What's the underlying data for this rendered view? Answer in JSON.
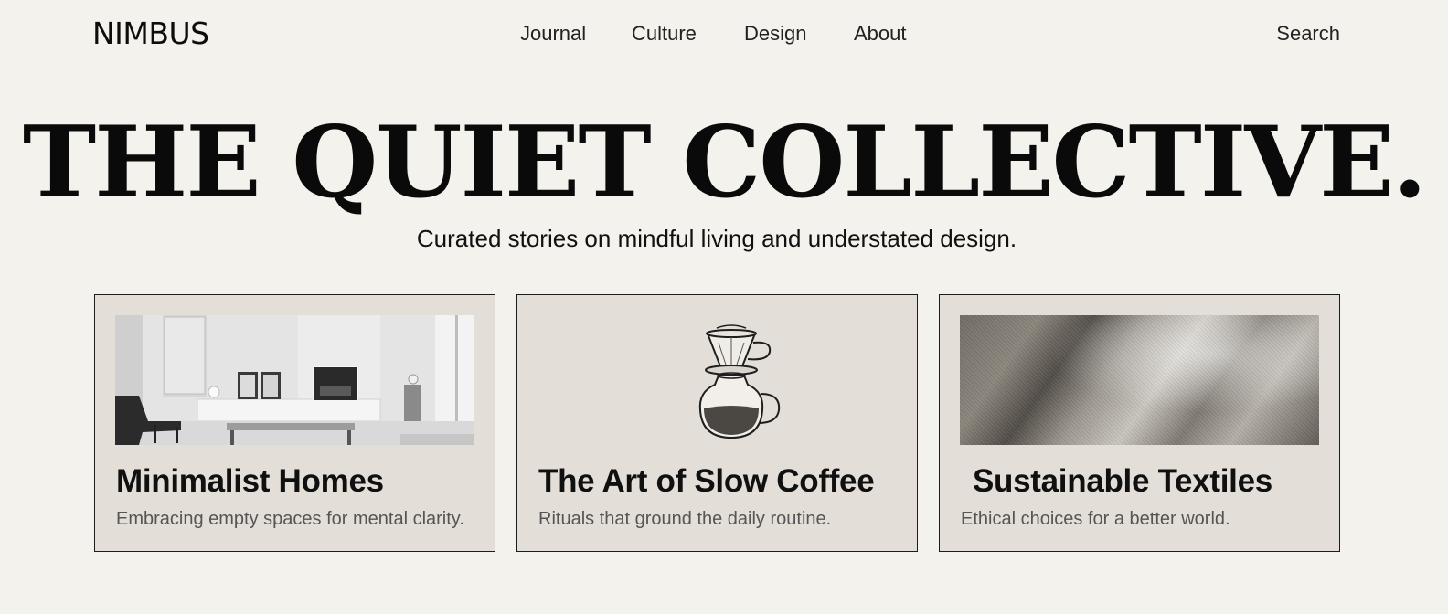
{
  "header": {
    "logo": "NIMBUS",
    "nav": [
      {
        "label": "Journal"
      },
      {
        "label": "Culture"
      },
      {
        "label": "Design"
      },
      {
        "label": "About"
      }
    ],
    "search_label": "Search"
  },
  "hero": {
    "title": "THE QUIET COLLECTIVE.",
    "subtitle": "Curated stories on mindful living and understated design."
  },
  "cards": [
    {
      "title": "Minimalist Homes",
      "description": "Embracing empty spaces for mental clarity.",
      "image": "minimalist-room-photo"
    },
    {
      "title": "The Art of Slow Coffee",
      "description": "Rituals that ground the daily routine.",
      "image": "pour-over-coffee-illustration"
    },
    {
      "title": "Sustainable Textiles",
      "description": "Ethical choices for a better world.",
      "image": "linen-fabric-photo"
    }
  ],
  "colors": {
    "background": "#f4f2ec",
    "card_background": "#e3dfd8",
    "text": "#111111",
    "muted_text": "#555555",
    "rule": "#1a1a1a"
  }
}
